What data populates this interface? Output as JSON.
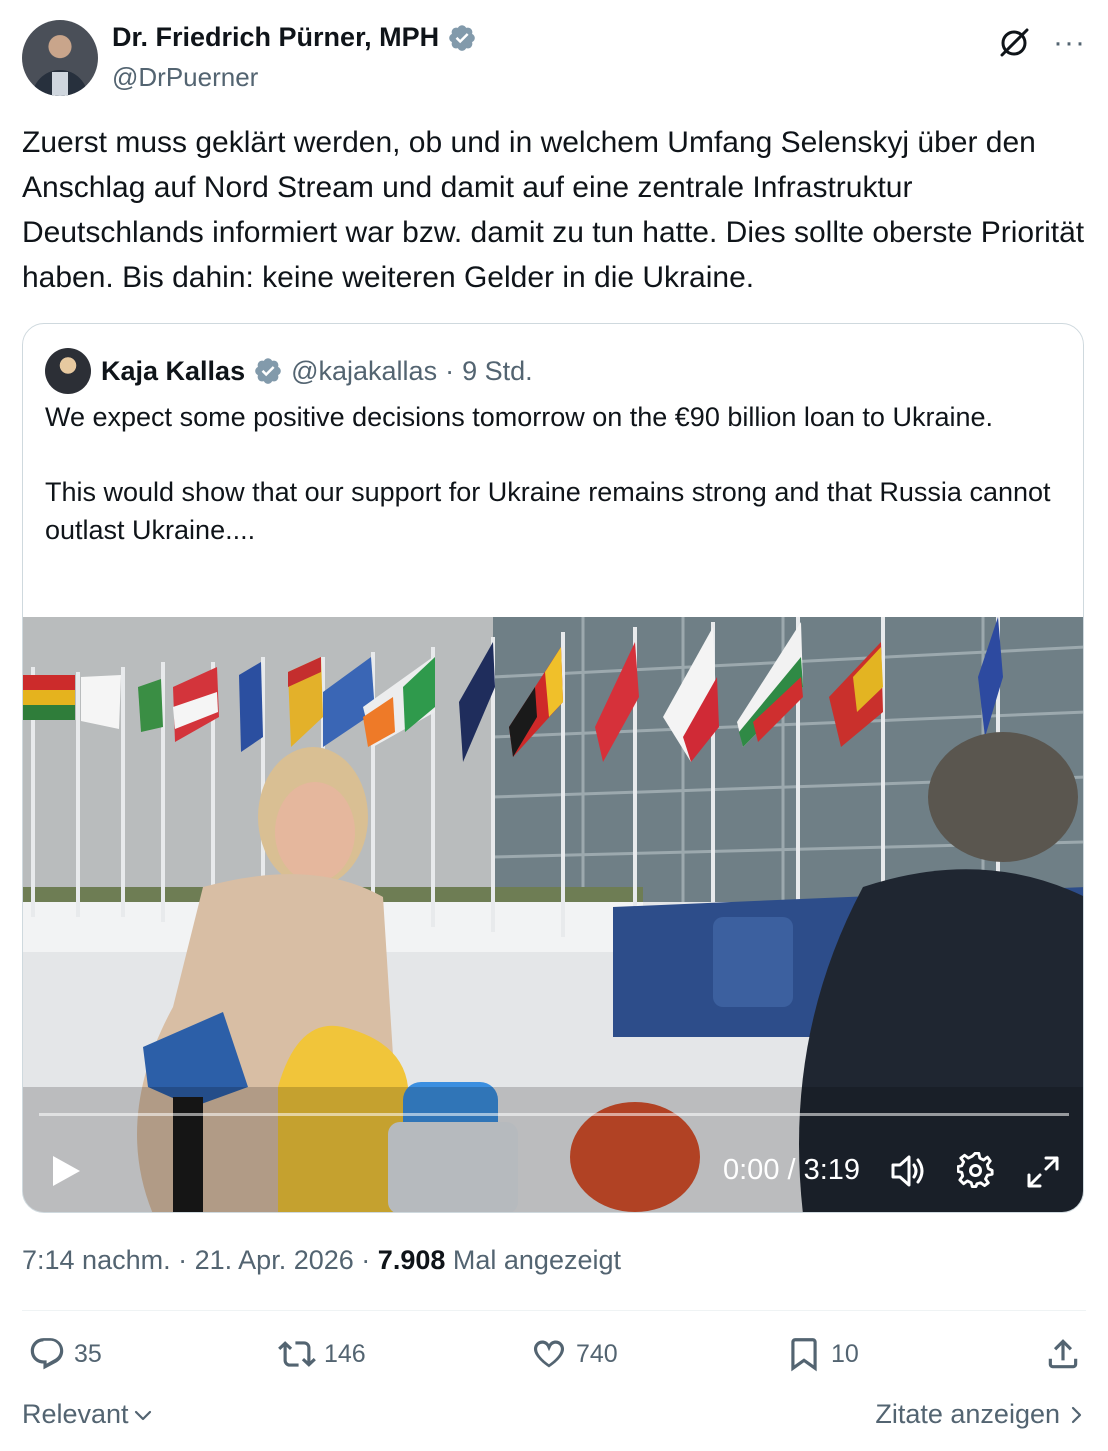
{
  "author": {
    "name": "Dr. Friedrich Pürner, MPH",
    "handle": "@DrPuerner",
    "verified_icon": "verified-badge-icon"
  },
  "header_icons": [
    "grok-icon",
    "more-icon"
  ],
  "more_label": "···",
  "tweet": {
    "text": "Zuerst muss geklärt werden, ob und in welchem Umfang Selenskyj über den Anschlag auf Nord Stream und damit auf eine zentrale Infrastruktur Deutschlands informiert war bzw. damit zu tun hatte. Dies sollte oberste Priorität haben. Bis dahin: keine weiteren Gelder in die Ukraine."
  },
  "quoted_tweet": {
    "name": "Kaja Kallas",
    "handle": "@kajakallas",
    "separator": "·",
    "time": "9 Std.",
    "text": "We expect some positive decisions tomorrow on the €90 billion loan to Ukraine.\n\nThis would show that our support for Ukraine remains strong and that Russia cannot outlast Ukraine....",
    "video": {
      "time_display": "0:00 / 3:19",
      "progress": 0,
      "controls": [
        "play-icon",
        "volume-icon",
        "settings-icon",
        "fullscreen-icon"
      ]
    }
  },
  "meta": {
    "time": "7:14 nachm.",
    "sep1": "·",
    "date": "21. Apr. 2026",
    "sep2": "·",
    "views": "7.908",
    "views_label": "Mal angezeigt"
  },
  "actions": {
    "replies": "35",
    "retweets": "146",
    "likes": "740",
    "bookmarks": "10"
  },
  "footer": {
    "sort_label": "Relevant",
    "quotes_label": "Zitate anzeigen"
  },
  "colors": {
    "text": "#0f1419",
    "secondary": "#536471",
    "verified": "#829aab",
    "border": "#cfd9de"
  }
}
